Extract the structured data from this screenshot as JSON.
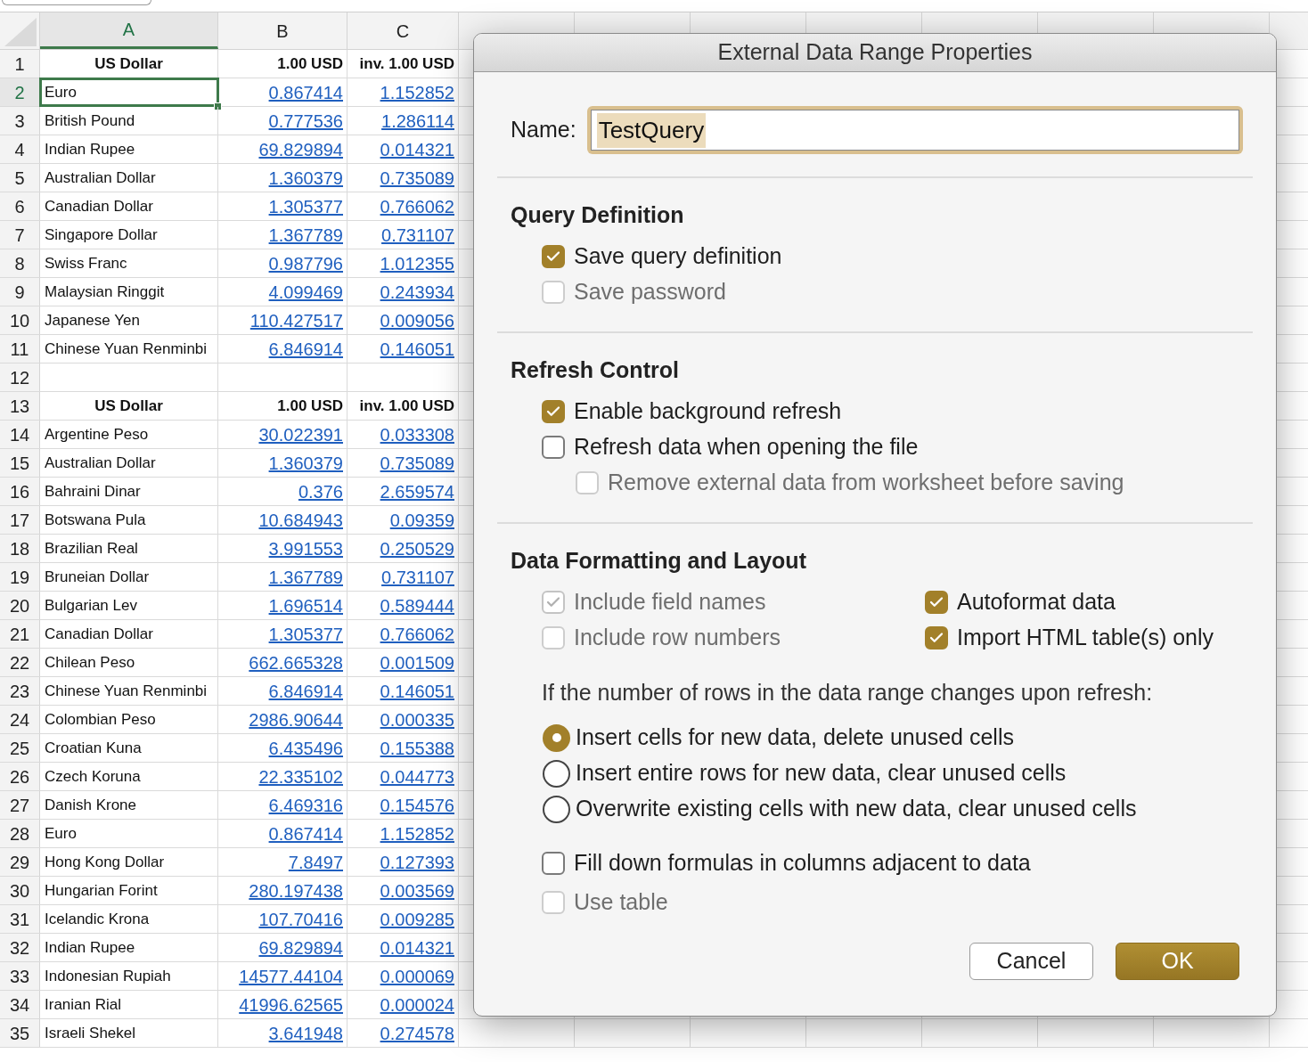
{
  "sheet": {
    "columns": [
      {
        "label": "A",
        "selected": true
      },
      {
        "label": "B",
        "selected": false
      },
      {
        "label": "C",
        "selected": false
      }
    ],
    "rows": [
      {
        "row": "1",
        "kind": "header",
        "selected": false,
        "cells": [
          "US Dollar",
          "1.00 USD",
          "inv. 1.00 USD"
        ]
      },
      {
        "row": "2",
        "kind": "data",
        "selected": true,
        "cells": [
          "Euro",
          "0.867414",
          "1.152852"
        ]
      },
      {
        "row": "3",
        "kind": "data",
        "selected": false,
        "cells": [
          "British Pound",
          "0.777536",
          "1.286114"
        ]
      },
      {
        "row": "4",
        "kind": "data",
        "selected": false,
        "cells": [
          "Indian Rupee",
          "69.829894",
          "0.014321"
        ]
      },
      {
        "row": "5",
        "kind": "data",
        "selected": false,
        "cells": [
          "Australian Dollar",
          "1.360379",
          "0.735089"
        ]
      },
      {
        "row": "6",
        "kind": "data",
        "selected": false,
        "cells": [
          "Canadian Dollar",
          "1.305377",
          "0.766062"
        ]
      },
      {
        "row": "7",
        "kind": "data",
        "selected": false,
        "cells": [
          "Singapore Dollar",
          "1.367789",
          "0.731107"
        ]
      },
      {
        "row": "8",
        "kind": "data",
        "selected": false,
        "cells": [
          "Swiss Franc",
          "0.987796",
          "1.012355"
        ]
      },
      {
        "row": "9",
        "kind": "data",
        "selected": false,
        "cells": [
          "Malaysian Ringgit",
          "4.099469",
          "0.243934"
        ]
      },
      {
        "row": "10",
        "kind": "data",
        "selected": false,
        "cells": [
          "Japanese Yen",
          "110.427517",
          "0.009056"
        ]
      },
      {
        "row": "11",
        "kind": "data",
        "selected": false,
        "cells": [
          "Chinese Yuan Renminbi",
          "6.846914",
          "0.146051"
        ]
      },
      {
        "row": "12",
        "kind": "blank",
        "selected": false
      },
      {
        "row": "13",
        "kind": "header",
        "selected": false,
        "cells": [
          "US Dollar",
          "1.00 USD",
          "inv. 1.00 USD"
        ]
      },
      {
        "row": "14",
        "kind": "data",
        "selected": false,
        "cells": [
          "Argentine Peso",
          "30.022391",
          "0.033308"
        ]
      },
      {
        "row": "15",
        "kind": "data",
        "selected": false,
        "cells": [
          "Australian Dollar",
          "1.360379",
          "0.735089"
        ]
      },
      {
        "row": "16",
        "kind": "data",
        "selected": false,
        "cells": [
          "Bahraini Dinar",
          "0.376",
          "2.659574"
        ]
      },
      {
        "row": "17",
        "kind": "data",
        "selected": false,
        "cells": [
          "Botswana Pula",
          "10.684943",
          "0.09359"
        ]
      },
      {
        "row": "18",
        "kind": "data",
        "selected": false,
        "cells": [
          "Brazilian Real",
          "3.991553",
          "0.250529"
        ]
      },
      {
        "row": "19",
        "kind": "data",
        "selected": false,
        "cells": [
          "Bruneian Dollar",
          "1.367789",
          "0.731107"
        ]
      },
      {
        "row": "20",
        "kind": "data",
        "selected": false,
        "cells": [
          "Bulgarian Lev",
          "1.696514",
          "0.589444"
        ]
      },
      {
        "row": "21",
        "kind": "data",
        "selected": false,
        "cells": [
          "Canadian Dollar",
          "1.305377",
          "0.766062"
        ]
      },
      {
        "row": "22",
        "kind": "data",
        "selected": false,
        "cells": [
          "Chilean Peso",
          "662.665328",
          "0.001509"
        ]
      },
      {
        "row": "23",
        "kind": "data",
        "selected": false,
        "cells": [
          "Chinese Yuan Renminbi",
          "6.846914",
          "0.146051"
        ]
      },
      {
        "row": "24",
        "kind": "data",
        "selected": false,
        "cells": [
          "Colombian Peso",
          "2986.90644",
          "0.000335"
        ]
      },
      {
        "row": "25",
        "kind": "data",
        "selected": false,
        "cells": [
          "Croatian Kuna",
          "6.435496",
          "0.155388"
        ]
      },
      {
        "row": "26",
        "kind": "data",
        "selected": false,
        "cells": [
          "Czech Koruna",
          "22.335102",
          "0.044773"
        ]
      },
      {
        "row": "27",
        "kind": "data",
        "selected": false,
        "cells": [
          "Danish Krone",
          "6.469316",
          "0.154576"
        ]
      },
      {
        "row": "28",
        "kind": "data",
        "selected": false,
        "cells": [
          "Euro",
          "0.867414",
          "1.152852"
        ]
      },
      {
        "row": "29",
        "kind": "data",
        "selected": false,
        "cells": [
          "Hong Kong Dollar",
          "7.8497",
          "0.127393"
        ]
      },
      {
        "row": "30",
        "kind": "data",
        "selected": false,
        "cells": [
          "Hungarian Forint",
          "280.197438",
          "0.003569"
        ]
      },
      {
        "row": "31",
        "kind": "data",
        "selected": false,
        "cells": [
          "Icelandic Krona",
          "107.70416",
          "0.009285"
        ]
      },
      {
        "row": "32",
        "kind": "data",
        "selected": false,
        "cells": [
          "Indian Rupee",
          "69.829894",
          "0.014321"
        ]
      },
      {
        "row": "33",
        "kind": "data",
        "selected": false,
        "cells": [
          "Indonesian Rupiah",
          "14577.44104",
          "0.000069"
        ]
      },
      {
        "row": "34",
        "kind": "data",
        "selected": false,
        "cells": [
          "Iranian Rial",
          "41996.62565",
          "0.000024"
        ]
      },
      {
        "row": "35",
        "kind": "data",
        "selected": false,
        "cells": [
          "Israeli Shekel",
          "3.641948",
          "0.274578"
        ]
      }
    ]
  },
  "dialog": {
    "title": "External Data Range Properties",
    "name_label": "Name:",
    "name_value": "TestQuery",
    "value_selected": true,
    "query_definition": {
      "heading": "Query Definition",
      "options": [
        {
          "label": "Save query definition",
          "checked": true,
          "disabled": false
        },
        {
          "label": "Save password",
          "checked": false,
          "disabled": true
        }
      ]
    },
    "refresh_control": {
      "heading": "Refresh Control",
      "options": [
        {
          "label": "Enable background refresh",
          "checked": true,
          "disabled": false
        },
        {
          "label": "Refresh data when opening the file",
          "checked": false,
          "disabled": false,
          "children": [
            {
              "label": "Remove external data from worksheet before saving",
              "checked": false,
              "disabled": true
            }
          ]
        }
      ]
    },
    "data_formatting": {
      "heading": "Data Formatting and Layout",
      "grid_options": [
        {
          "label": "Include field names",
          "checked": true,
          "disabled": true
        },
        {
          "label": "Autoformat data",
          "checked": true,
          "disabled": false
        },
        {
          "label": "Include row numbers",
          "checked": false,
          "disabled": true
        },
        {
          "label": "Import HTML table(s) only",
          "checked": true,
          "disabled": false
        }
      ],
      "prompt": "If the number of rows in the data range changes upon refresh:",
      "radios": [
        {
          "label": "Insert cells for new data, delete unused cells",
          "selected": true
        },
        {
          "label": "Insert entire rows for new data, clear unused cells",
          "selected": false
        },
        {
          "label": "Overwrite existing cells with new data, clear unused cells",
          "selected": false
        }
      ],
      "options": [
        {
          "label": "Fill down formulas in columns adjacent to data",
          "checked": false,
          "disabled": false
        },
        {
          "label": "Use table",
          "checked": false,
          "disabled": true
        }
      ]
    },
    "buttons": [
      {
        "label": "Cancel",
        "kind": "secondary"
      },
      {
        "label": "OK",
        "kind": "primary"
      }
    ]
  }
}
